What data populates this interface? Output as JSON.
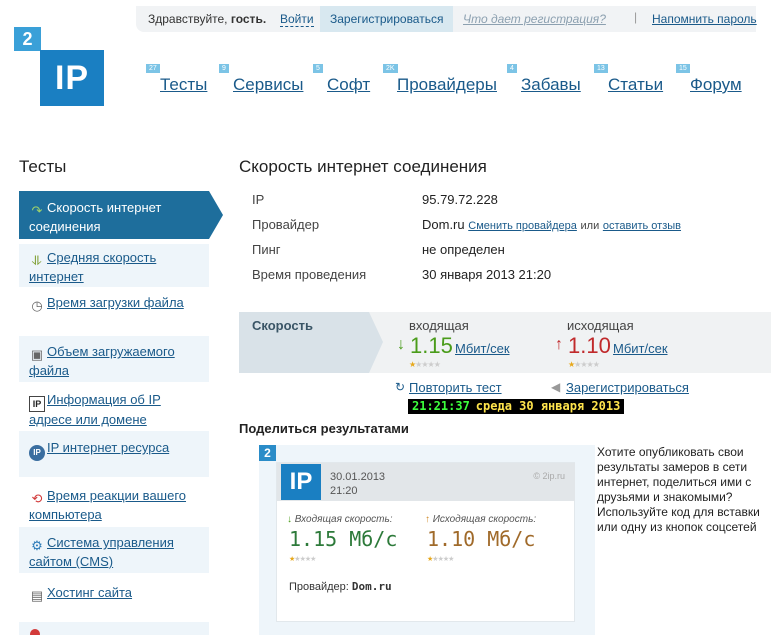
{
  "topbar": {
    "greeting_prefix": "Здравствуйте,",
    "greeting_user": "гость.",
    "login": "Войти",
    "register": "Зарегистрироваться",
    "what_gives": "Что дает регистрация?",
    "separator": "|",
    "remind_password": "Напомнить пароль"
  },
  "logo": {
    "badge": "2",
    "text": "IP"
  },
  "nav": [
    {
      "badge": "27",
      "label": "Тесты"
    },
    {
      "badge": "9",
      "label": "Сервисы"
    },
    {
      "badge": "5",
      "label": "Софт"
    },
    {
      "badge": "2K",
      "label": "Провайдеры"
    },
    {
      "badge": "4",
      "label": "Забавы"
    },
    {
      "badge": "13",
      "label": "Статьи"
    },
    {
      "badge": "15",
      "label": "Форум"
    }
  ],
  "sidebar": {
    "title": "Тесты",
    "items": [
      {
        "icon": "speed-icon",
        "label": "Скорость интернет соединения",
        "active": true
      },
      {
        "icon": "bars-icon",
        "label": "Средняя скорость интернет"
      },
      {
        "icon": "clock-icon",
        "label": "Время загрузки файла"
      },
      {
        "icon": "volume-icon",
        "label": "Объем загружаемого файла"
      },
      {
        "icon": "ip-icon",
        "label": "Информация об IP адресе или домене"
      },
      {
        "icon": "ip-resource-icon",
        "label": "IP интернет ресурса"
      },
      {
        "icon": "reaction-icon",
        "label": "Время реакции вашего компьютера"
      },
      {
        "icon": "cms-icon",
        "label": "Система управления сайтом (CMS)"
      },
      {
        "icon": "hosting-icon",
        "label": "Хостинг сайта"
      }
    ]
  },
  "main": {
    "title": "Скорость интернет соединения",
    "info": {
      "ip_label": "IP",
      "ip_value": "95.79.72.228",
      "provider_label": "Провайдер",
      "provider_value": "Dom.ru",
      "change_provider": "Сменить провайдера",
      "or": "или",
      "leave_review": "оставить отзыв",
      "ping_label": "Пинг",
      "ping_value": "не определен",
      "time_label": "Время проведения",
      "time_value": "30 января 2013 21:20"
    },
    "speed": {
      "label": "Скорость",
      "incoming_label": "входящая",
      "incoming_value": "1.15",
      "incoming_unit": "Мбит/сек",
      "incoming_stars": 1,
      "outgoing_label": "исходящая",
      "outgoing_value": "1.10",
      "outgoing_unit": "Мбит/сек",
      "outgoing_stars": 1,
      "max_stars": 5
    },
    "actions": {
      "repeat": "Повторить тест",
      "register": "Зарегистрироваться"
    },
    "clock": {
      "time": "21:21:37",
      "date": "среда 30 января 2013"
    },
    "share": {
      "title": "Поделиться результатами",
      "text": "Хотите опубликовать свои результаты замеров в сети интернет, поделиться ими с друзьями и знакомыми? Используйте код для вставки или одну из кнопок соцсетей"
    },
    "card": {
      "badge": "2",
      "logo": "IP",
      "date": "30.01.2013",
      "time": "21:20",
      "brand": "© 2ip.ru",
      "in_label": "Входящая скорость:",
      "in_value": "1.15 Мб/с",
      "out_label": "Исходящая скорость:",
      "out_value": "1.10 Мб/с",
      "provider_label": "Провайдер:",
      "provider_value": "Dom.ru"
    }
  },
  "colors": {
    "brand_blue": "#1a7fc2",
    "link": "#1a5a8a",
    "active_sidebar": "#1e6e9c",
    "incoming_green": "#4a9c1a",
    "outgoing_red": "#c0292b"
  }
}
